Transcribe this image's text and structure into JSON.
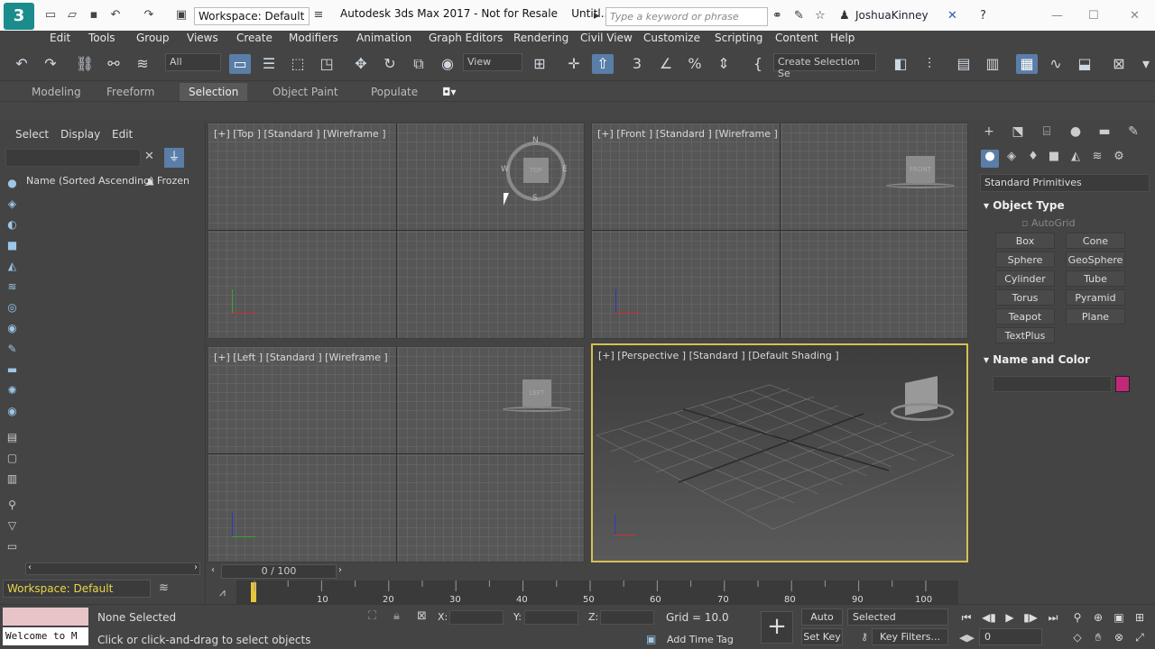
{
  "title": {
    "workspace": "Workspace: Default",
    "app_title": "Autodesk 3ds Max 2017 - Not for Resale",
    "doc_title": "Untitl...",
    "search_placeholder": "Type a keyword or phrase",
    "user": "JoshuaKinney"
  },
  "menu": [
    "Edit",
    "Tools",
    "Group",
    "Views",
    "Create",
    "Modifiers",
    "Animation",
    "Graph Editors",
    "Rendering",
    "Civil View",
    "Customize",
    "Scripting",
    "Content",
    "Help"
  ],
  "toolbar": {
    "filter": "All",
    "ref_coord": "View",
    "named_sel": "Create Selection Se"
  },
  "ribbon": {
    "tabs": [
      "Modeling",
      "Freeform",
      "Selection",
      "Object Paint",
      "Populate"
    ],
    "active": "Selection"
  },
  "scene": {
    "menu": [
      "Select",
      "Display",
      "Edit"
    ],
    "col_name": "Name (Sorted Ascending)",
    "col_frozen": "▲ Frozen",
    "workspace": "Workspace: Default"
  },
  "viewports": {
    "top": "[+] [Top ] [Standard ] [Wireframe ]",
    "front": "[+] [Front ] [Standard ] [Wireframe ]",
    "left": "[+] [Left ] [Standard ] [Wireframe ]",
    "persp": "[+] [Perspective ] [Standard ] [Default Shading ]",
    "compass": {
      "n": "N",
      "s": "S",
      "e": "E",
      "w": "W"
    },
    "cube_top": "TOP",
    "cube_front": "FRONT",
    "cube_left": "LEFT"
  },
  "command": {
    "category": "Standard Primitives",
    "object_type": "Object Type",
    "autogrid": "AutoGrid",
    "buttons": [
      "Box",
      "Cone",
      "Sphere",
      "GeoSphere",
      "Cylinder",
      "Tube",
      "Torus",
      "Pyramid",
      "Teapot",
      "Plane",
      "TextPlus"
    ],
    "name_color": "Name and Color",
    "swatch": "#c0287a"
  },
  "timeline": {
    "frame": "0 / 100",
    "ticks": [
      "10",
      "20",
      "30",
      "40",
      "50",
      "60",
      "70",
      "80",
      "90",
      "100"
    ]
  },
  "status": {
    "maxscript": "Welcome to M",
    "selected": "None Selected",
    "prompt": "Click or click-and-drag to select objects",
    "x": "X:",
    "y": "Y:",
    "z": "Z:",
    "grid": "Grid = 10.0",
    "time_tag": "Add Time Tag",
    "auto_key": "Auto Key",
    "set_key": "Set Key",
    "selected_dd": "Selected",
    "key_filters": "Key Filters...",
    "frame_field": "0"
  }
}
